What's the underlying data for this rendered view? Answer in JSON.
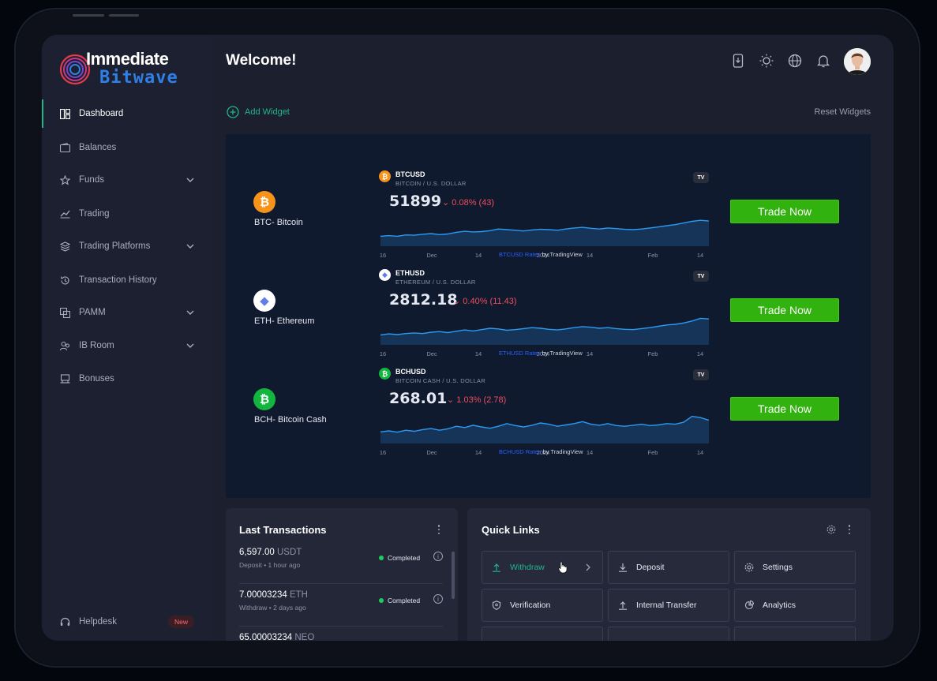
{
  "brand": {
    "line1": "Immediate",
    "line2": "Bitwave"
  },
  "header": {
    "title": "Welcome!"
  },
  "sidebar": {
    "items": [
      {
        "label": "Dashboard",
        "icon": "dashboard-icon"
      },
      {
        "label": "Balances",
        "icon": "wallet-icon"
      },
      {
        "label": "Funds",
        "icon": "star-icon"
      },
      {
        "label": "Trading",
        "icon": "chart-line-icon"
      },
      {
        "label": "Trading Platforms",
        "icon": "layers-icon"
      },
      {
        "label": "Transaction History",
        "icon": "history-icon"
      },
      {
        "label": "PAMM",
        "icon": "copy-icon"
      },
      {
        "label": "IB Room",
        "icon": "users-icon"
      },
      {
        "label": "Bonuses",
        "icon": "gift-icon"
      }
    ],
    "helpdesk": {
      "label": "Helpdesk",
      "badge": "New"
    }
  },
  "toolbar": {
    "add_widget": "Add Widget",
    "reset_widgets": "Reset Widgets"
  },
  "colors": {
    "accent": "#1fb68a",
    "trade": "#32b20f",
    "negative": "#ef4d5d",
    "widget_bg": "#0f1a2e"
  },
  "coins": [
    {
      "name": "BTC- Bitcoin",
      "symbol": "BTCUSD",
      "description": "BITCOIN / U.S. DOLLAR",
      "price": "51899",
      "change": "0.08% (43)",
      "logo_color": "#f7931a",
      "logo_glyph": "₿",
      "x_labels": [
        "16",
        "Dec",
        "14",
        "2024",
        "14",
        "Feb",
        "14"
      ],
      "credit_link": "BTCUSD Rates",
      "credit_by": "by TradingView",
      "button": "Trade Now",
      "spark": [
        0.3,
        0.32,
        0.3,
        0.34,
        0.33,
        0.36,
        0.38,
        0.35,
        0.37,
        0.42,
        0.45,
        0.43,
        0.44,
        0.47,
        0.52,
        0.5,
        0.48,
        0.46,
        0.49,
        0.51,
        0.5,
        0.48,
        0.52,
        0.55,
        0.57,
        0.54,
        0.52,
        0.55,
        0.53,
        0.51,
        0.5,
        0.52,
        0.55,
        0.58,
        0.62,
        0.65,
        0.7,
        0.75,
        0.78,
        0.76
      ]
    },
    {
      "name": "ETH- Ethereum",
      "symbol": "ETHUSD",
      "description": "ETHEREUM / U.S. DOLLAR",
      "price": "2812.18",
      "change": "0.40% (11.43)",
      "logo_color": "#ffffff",
      "logo_glyph": "◆",
      "x_labels": [
        "16",
        "Dec",
        "14",
        "2024",
        "14",
        "Feb",
        "14"
      ],
      "credit_link": "ETHUSD Rates",
      "credit_by": "by TradingView",
      "button": "Trade Now",
      "spark": [
        0.3,
        0.33,
        0.31,
        0.34,
        0.36,
        0.34,
        0.38,
        0.4,
        0.37,
        0.41,
        0.45,
        0.42,
        0.46,
        0.5,
        0.48,
        0.44,
        0.46,
        0.49,
        0.52,
        0.5,
        0.47,
        0.45,
        0.48,
        0.52,
        0.55,
        0.53,
        0.5,
        0.52,
        0.49,
        0.47,
        0.46,
        0.49,
        0.52,
        0.56,
        0.6,
        0.62,
        0.66,
        0.72,
        0.8,
        0.78
      ]
    },
    {
      "name": "BCH- Bitcoin Cash",
      "symbol": "BCHUSD",
      "description": "BITCOIN CASH / U.S. DOLLAR",
      "price": "268.01",
      "change": "1.03% (2.78)",
      "logo_color": "#12b63f",
      "logo_glyph": "₿",
      "x_labels": [
        "16",
        "Dec",
        "14",
        "2024",
        "14",
        "Feb",
        "14"
      ],
      "credit_link": "BCHUSD Rates",
      "credit_by": "by TradingView",
      "button": "Trade Now",
      "spark": [
        0.35,
        0.38,
        0.34,
        0.4,
        0.37,
        0.42,
        0.45,
        0.4,
        0.44,
        0.52,
        0.48,
        0.55,
        0.5,
        0.46,
        0.52,
        0.6,
        0.54,
        0.5,
        0.55,
        0.62,
        0.58,
        0.52,
        0.56,
        0.6,
        0.66,
        0.58,
        0.55,
        0.6,
        0.54,
        0.52,
        0.55,
        0.58,
        0.54,
        0.56,
        0.6,
        0.58,
        0.64,
        0.82,
        0.78,
        0.7
      ]
    }
  ],
  "transactions": {
    "title": "Last Transactions",
    "items": [
      {
        "amount": "6,597.00",
        "currency": "USDT",
        "type": "Deposit",
        "time": "1 hour ago",
        "status": "Completed"
      },
      {
        "amount": "7.00003234",
        "currency": "ETH",
        "type": "Withdraw",
        "time": "2 days ago",
        "status": "Completed"
      },
      {
        "amount": "65.00003234",
        "currency": "NEO",
        "type": "",
        "time": "",
        "status": ""
      }
    ]
  },
  "quick_links": {
    "title": "Quick Links",
    "items": [
      {
        "label": "Withdraw",
        "icon": "upload-icon",
        "active": true
      },
      {
        "label": "Deposit",
        "icon": "download-icon"
      },
      {
        "label": "Settings",
        "icon": "gear-icon"
      },
      {
        "label": "Verification",
        "icon": "shield-icon"
      },
      {
        "label": "Internal Transfer",
        "icon": "upload-icon"
      },
      {
        "label": "Analytics",
        "icon": "pie-chart-icon"
      }
    ]
  }
}
